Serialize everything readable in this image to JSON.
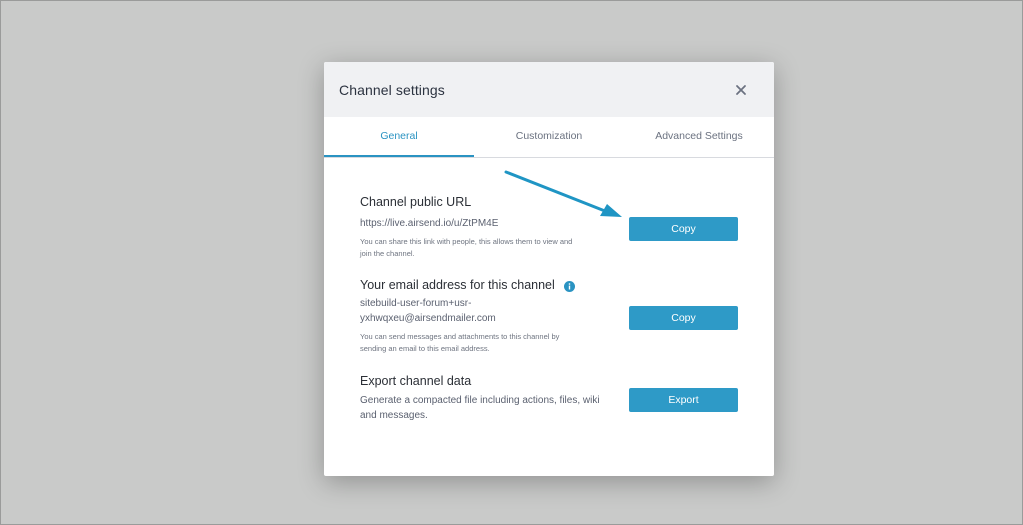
{
  "modal": {
    "title": "Channel settings",
    "close_icon": "close-icon",
    "tabs": [
      {
        "label": "General",
        "active": true
      },
      {
        "label": "Customization",
        "active": false
      },
      {
        "label": "Advanced Settings",
        "active": false
      }
    ],
    "sections": {
      "public_url": {
        "title": "Channel public URL",
        "value": "https://live.airsend.io/u/ZtPM4E",
        "help_line1": "You can share this link with people, this allows them to view and",
        "help_line2": "join the channel.",
        "button_label": "Copy"
      },
      "email": {
        "title": "Your email address for this channel",
        "info_icon": "info-icon",
        "value_line1": "sitebuild-user-forum+usr-",
        "value_line2": "yxhwqxeu@airsendmailer.com",
        "help_line1": "You can send messages and attachments to this channel by",
        "help_line2": "sending an email to this email address.",
        "button_label": "Copy"
      },
      "export": {
        "title": "Export channel data",
        "description_line1": "Generate a compacted file including actions, files, wiki",
        "description_line2": "and messages.",
        "button_label": "Export"
      }
    }
  },
  "colors": {
    "accent": "#2a93c2",
    "button": "#2e9ac7",
    "backdrop": "#c9cac9",
    "header_bg": "#f0f1f3"
  }
}
